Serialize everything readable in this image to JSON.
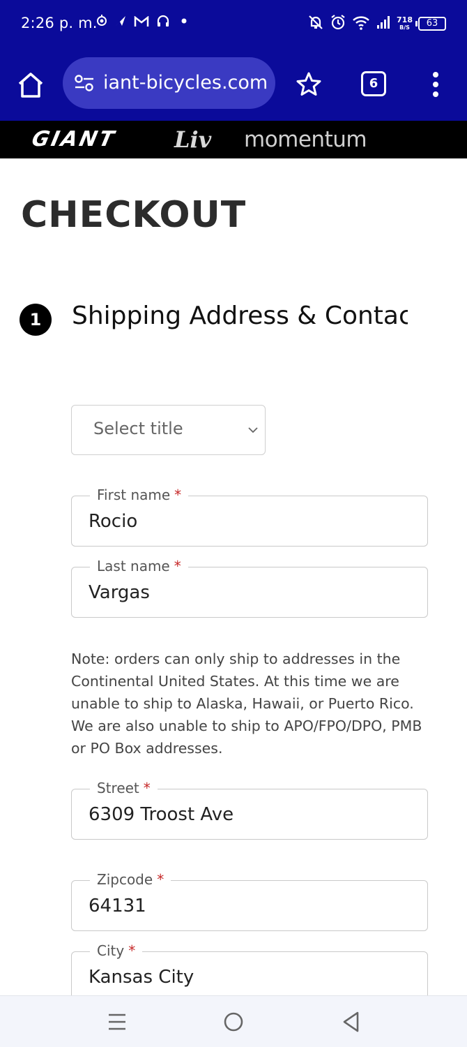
{
  "status_bar": {
    "time": "2:26 p. m.",
    "data_rate_value": "718",
    "data_rate_unit": "B/S",
    "battery": "63",
    "icons": [
      "notification-icon",
      "send-icon",
      "gmail-icon",
      "headset-icon",
      "dot-icon",
      "mute-icon",
      "alarm-icon",
      "wifi-icon",
      "signal-icon",
      "battery-icon"
    ]
  },
  "browser": {
    "url": "iant-bicycles.com",
    "tab_count": "6",
    "icons": [
      "home-icon",
      "site-settings-icon",
      "bookmark-star-icon",
      "tabs-icon",
      "more-vert-icon"
    ]
  },
  "brands": {
    "giant": "GIANT",
    "liv": "Liv",
    "momentum": "momentum"
  },
  "page": {
    "title": "CHECKOUT",
    "step_number": "1",
    "step_title": "Shipping Address & Contact"
  },
  "form": {
    "title_select": {
      "placeholder": "Select title"
    },
    "first_name": {
      "label": "First name",
      "required": "*",
      "value": "Rocio"
    },
    "last_name": {
      "label": "Last name",
      "required": "*",
      "value": "Vargas"
    },
    "note": "Note: orders can only ship to addresses in the Continental United States. At this time we are unable to ship to Alaska, Hawaii, or Puerto Rico. We are also unable to ship to APO/FPO/DPO, PMB or PO Box addresses.",
    "street": {
      "label": "Street",
      "required": "*",
      "value": "6309 Troost Ave"
    },
    "zipcode": {
      "label": "Zipcode",
      "required": "*",
      "value": "64131"
    },
    "city": {
      "label": "City",
      "required": "*",
      "value": "Kansas City"
    }
  },
  "colors": {
    "browser_bar": "#0b0b9a",
    "url_pill": "#3a3ac2",
    "required_star": "#c62828",
    "brand_bar": "#000000"
  },
  "nav": {
    "icons": [
      "recents-icon",
      "home-circle-icon",
      "back-icon"
    ]
  }
}
